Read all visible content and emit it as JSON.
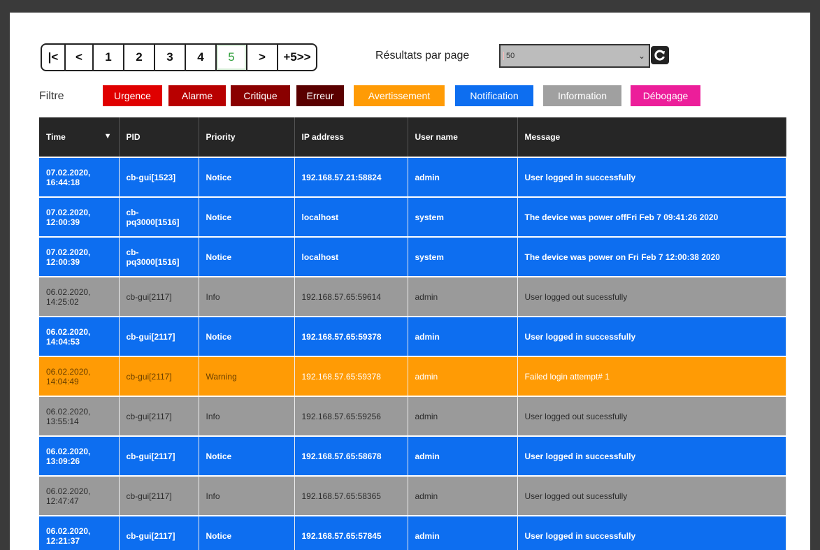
{
  "pagination": {
    "first": "|<",
    "prev": "<",
    "pages": [
      "1",
      "2",
      "3",
      "4",
      "5"
    ],
    "current": "5",
    "next": ">",
    "jump": "+5>>"
  },
  "per_page": {
    "label": "Résultats par page",
    "value": "50"
  },
  "filter": {
    "label": "Filtre",
    "chips": [
      {
        "label": "Urgence",
        "color": "#e00000"
      },
      {
        "label": "Alarme",
        "color": "#b80000"
      },
      {
        "label": "Critique",
        "color": "#8a0000"
      },
      {
        "label": "Erreur",
        "color": "#5a0000"
      },
      {
        "label": "Avertissement",
        "color": "#ff9b05"
      },
      {
        "label": "Notification",
        "color": "#0d6ef0"
      },
      {
        "label": "Information",
        "color": "#a0a0a0"
      },
      {
        "label": "Débogage",
        "color": "#ec1e9a"
      }
    ]
  },
  "table": {
    "columns": [
      "Time",
      "PID",
      "Priority",
      "IP address",
      "User name",
      "Message"
    ],
    "rows": [
      {
        "level": "notice",
        "time": "07.02.2020, 16:44:18",
        "pid": "cb-gui[1523]",
        "priority": "Notice",
        "ip": "192.168.57.21:58824",
        "user": "admin",
        "message": "User logged in successfully"
      },
      {
        "level": "notice",
        "time": "07.02.2020, 12:00:39",
        "pid": "cb-pq3000[1516]",
        "priority": "Notice",
        "ip": "localhost",
        "user": "system",
        "message": "The device was power offFri Feb 7 09:41:26 2020"
      },
      {
        "level": "notice",
        "time": "07.02.2020, 12:00:39",
        "pid": "cb-pq3000[1516]",
        "priority": "Notice",
        "ip": "localhost",
        "user": "system",
        "message": "The device was power on Fri Feb 7 12:00:38 2020"
      },
      {
        "level": "info",
        "time": "06.02.2020, 14:25:02",
        "pid": "cb-gui[2117]",
        "priority": "Info",
        "ip": "192.168.57.65:59614",
        "user": "admin",
        "message": "User logged out sucessfully"
      },
      {
        "level": "notice",
        "time": "06.02.2020, 14:04:53",
        "pid": "cb-gui[2117]",
        "priority": "Notice",
        "ip": "192.168.57.65:59378",
        "user": "admin",
        "message": "User logged in successfully"
      },
      {
        "level": "warning",
        "time": "06.02.2020, 14:04:49",
        "pid": "cb-gui[2117]",
        "priority": "Warning",
        "ip": "192.168.57.65:59378",
        "user": "admin",
        "message": "Failed login attempt# 1"
      },
      {
        "level": "info",
        "time": "06.02.2020, 13:55:14",
        "pid": "cb-gui[2117]",
        "priority": "Info",
        "ip": "192.168.57.65:59256",
        "user": "admin",
        "message": "User logged out sucessfully"
      },
      {
        "level": "notice",
        "time": "06.02.2020, 13:09:26",
        "pid": "cb-gui[2117]",
        "priority": "Notice",
        "ip": "192.168.57.65:58678",
        "user": "admin",
        "message": "User logged in successfully"
      },
      {
        "level": "info",
        "time": "06.02.2020, 12:47:47",
        "pid": "cb-gui[2117]",
        "priority": "Info",
        "ip": "192.168.57.65:58365",
        "user": "admin",
        "message": "User logged out sucessfully"
      },
      {
        "level": "notice",
        "time": "06.02.2020, 12:21:37",
        "pid": "cb-gui[2117]",
        "priority": "Notice",
        "ip": "192.168.57.65:57845",
        "user": "admin",
        "message": "User logged in successfully"
      }
    ]
  }
}
